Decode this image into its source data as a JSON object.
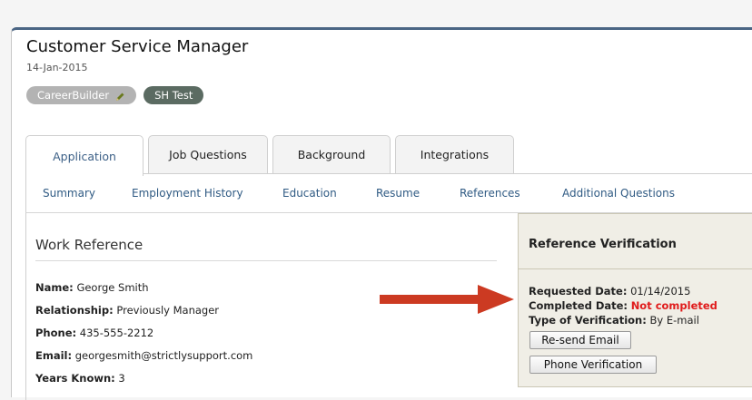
{
  "header": {
    "title": "Customer Service Manager",
    "date": "14-Jan-2015",
    "tags": [
      {
        "label": "CareerBuilder",
        "icon": "pencil-icon"
      },
      {
        "label": "SH Test"
      }
    ]
  },
  "tabs": [
    "Application",
    "Job Questions",
    "Background",
    "Integrations"
  ],
  "active_tab": "Application",
  "subnav": [
    "Summary",
    "Employment History",
    "Education",
    "Resume",
    "References",
    "Additional Questions"
  ],
  "work_reference": {
    "title": "Work Reference",
    "fields": [
      {
        "label": "Name:",
        "value": "George Smith"
      },
      {
        "label": "Relationship:",
        "value": "Previously Manager"
      },
      {
        "label": "Phone:",
        "value": "435-555-2212"
      },
      {
        "label": "Email:",
        "value": "georgesmith@strictlysupport.com"
      },
      {
        "label": "Years Known:",
        "value": "3"
      }
    ]
  },
  "verification": {
    "title": "Reference Verification",
    "requested_label": "Requested Date:",
    "requested_value": "01/14/2015",
    "completed_label": "Completed Date:",
    "completed_value": "Not completed",
    "type_label": "Type of Verification:",
    "type_value": "By E-mail",
    "resend_button": "Re-send Email",
    "phone_button": "Phone Verification"
  },
  "colors": {
    "accent": "#3b5f86",
    "annotation_arrow": "#cc3a22",
    "not_completed": "#e01b1b"
  }
}
